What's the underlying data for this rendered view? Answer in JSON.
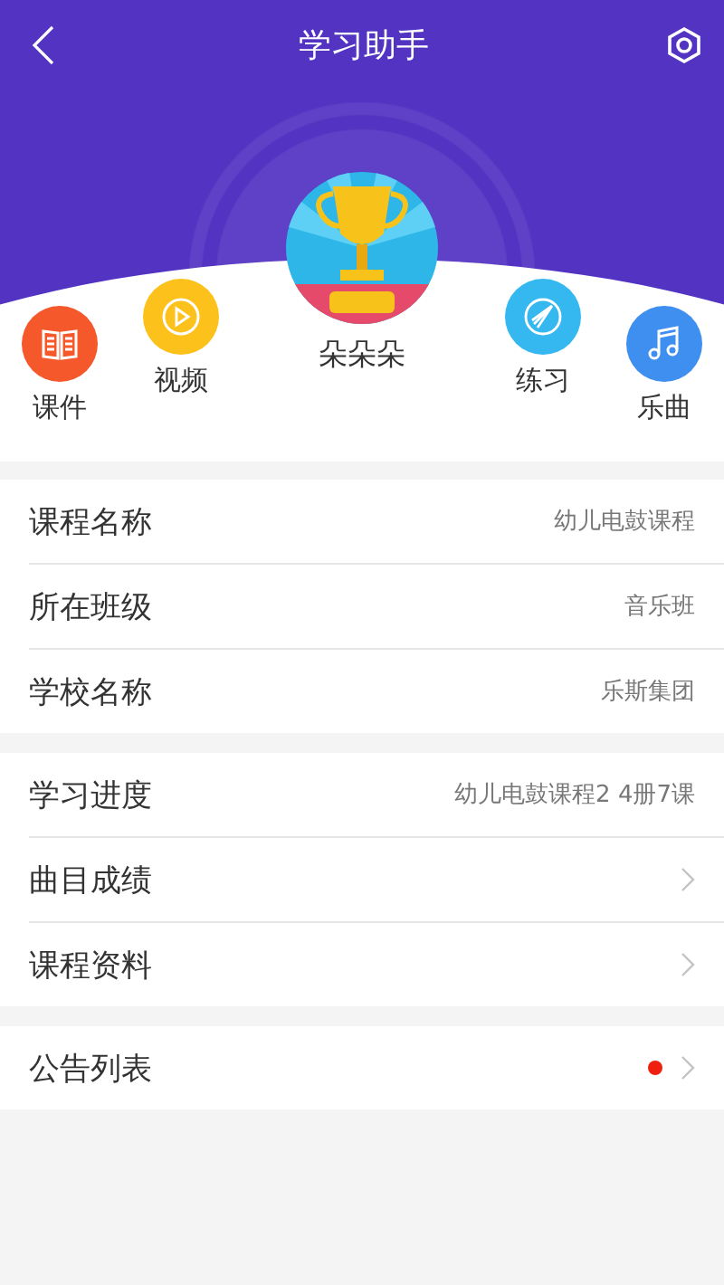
{
  "header": {
    "title": "学习助手"
  },
  "profile": {
    "name": "朵朵朵"
  },
  "shortcuts": [
    {
      "label": "课件",
      "kind": "book",
      "color": "#f4582b"
    },
    {
      "label": "视频",
      "kind": "play",
      "color": "#fcc21b"
    },
    {
      "label": "练习",
      "kind": "compass",
      "color": "#35b8f0"
    },
    {
      "label": "乐曲",
      "kind": "music",
      "color": "#3e8ff0"
    }
  ],
  "sections": [
    {
      "rows": [
        {
          "label": "课程名称",
          "kind": "value",
          "value": "幼儿电鼓课程"
        },
        {
          "label": "所在班级",
          "kind": "value",
          "value": "音乐班"
        },
        {
          "label": "学校名称",
          "kind": "value",
          "value": "乐斯集团"
        }
      ]
    },
    {
      "rows": [
        {
          "label": "学习进度",
          "kind": "value",
          "value": "幼儿电鼓课程2 4册7课"
        },
        {
          "label": "曲目成绩",
          "kind": "link",
          "unread": false
        },
        {
          "label": "课程资料",
          "kind": "link",
          "unread": false
        }
      ]
    },
    {
      "rows": [
        {
          "label": "公告列表",
          "kind": "link",
          "unread": true
        }
      ]
    }
  ]
}
